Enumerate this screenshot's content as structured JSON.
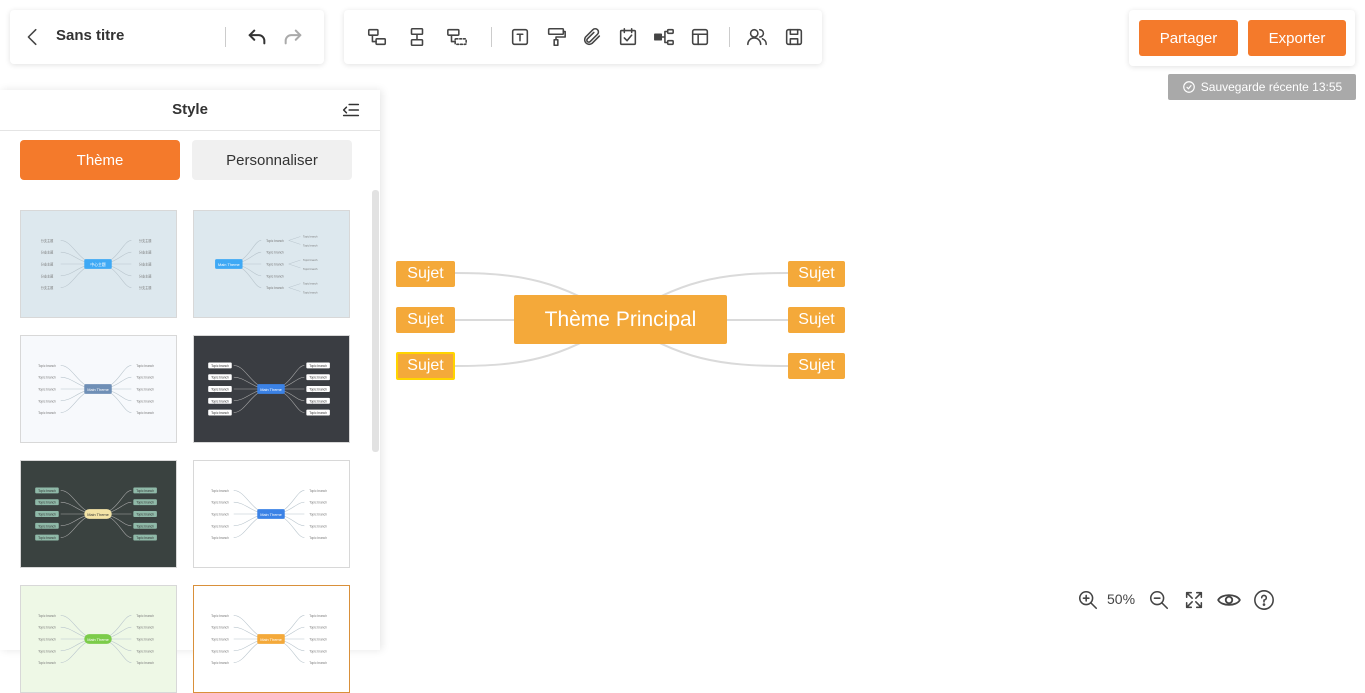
{
  "toolbar": {
    "title": "Sans titre"
  },
  "actions": {
    "share_label": "Partager",
    "export_label": "Exporter",
    "save_status": "Sauvegarde récente 13:55"
  },
  "style_panel": {
    "title": "Style",
    "tabs": [
      "Thème",
      "Personnaliser"
    ],
    "themes": [
      {
        "background": "#dde8ee",
        "center": "中心主题",
        "branch": "分支主题",
        "accent": "#3fa9f5"
      },
      {
        "background": "#dde8ee",
        "center": "Main Theme",
        "branch": "Topic branch",
        "accent": "#3fa9f5"
      },
      {
        "background": "#f7f9fc",
        "center": "Main Theme",
        "branch": "Topic branch",
        "accent": "#6f8fb6"
      },
      {
        "background": "#3a3d42",
        "center": "Main Theme",
        "branch": "Topic branch",
        "accent": "#3b82e6"
      },
      {
        "background": "#3a4240",
        "center": "Main Theme",
        "branch": "Topic branch",
        "accent": "#f3e3a6"
      },
      {
        "background": "#ffffff",
        "center": "Main Theme",
        "branch": "Topic branch",
        "accent": "#3b82e6"
      },
      {
        "background": "#eef8e6",
        "center": "Main Theme",
        "branch": "Topic branch",
        "accent": "#7ccc4a"
      },
      {
        "background": "#ffffff",
        "center": "Main Theme",
        "branch": "Topic branch",
        "accent": "#f4a93a"
      }
    ]
  },
  "mindmap": {
    "central_topic": "Thème Principal",
    "left_topics": [
      "Sujet",
      "Sujet",
      "Sujet"
    ],
    "right_topics": [
      "Sujet",
      "Sujet",
      "Sujet"
    ],
    "node_color": "#f4a93a",
    "selected_border": "#ffd400"
  },
  "zoom": {
    "level": "50%"
  },
  "colors": {
    "accent": "#f47a2b",
    "badge": "#a9a9a9"
  }
}
